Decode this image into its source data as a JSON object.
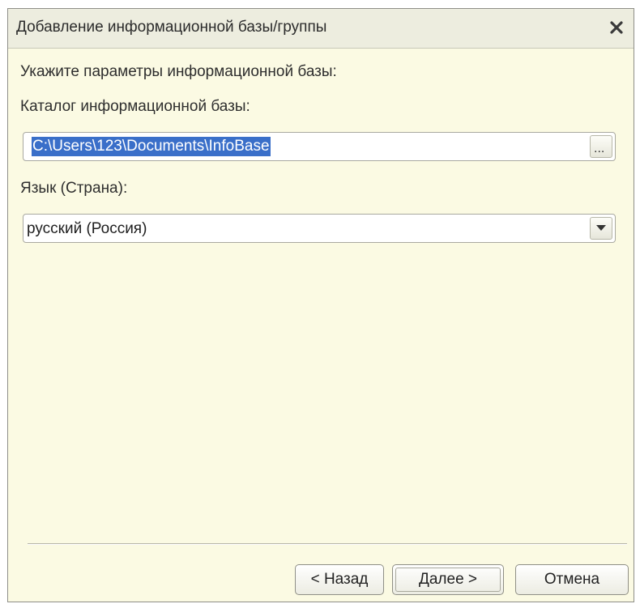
{
  "window": {
    "title": "Добавление информационной базы/группы",
    "close_icon": "close-icon"
  },
  "form": {
    "instruction": "Укажите параметры информационной базы:",
    "catalog_label": "Каталог информационной базы:",
    "catalog_value": "C:\\Users\\123\\Documents\\InfoBase",
    "browse_label": "...",
    "language_label": "Язык (Страна):",
    "language_value": "русский (Россия)",
    "dropdown_icon": "chevron-down-icon"
  },
  "buttons": {
    "back": "< Назад",
    "next": "Далее >",
    "cancel": "Отмена"
  },
  "colors": {
    "dialog_background": "#fbfae3",
    "titlebar_background": "#ededdf",
    "selection_highlight": "#3a6fc9"
  }
}
